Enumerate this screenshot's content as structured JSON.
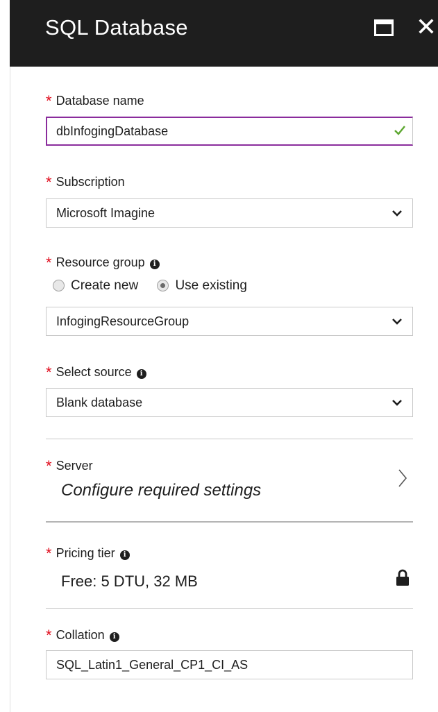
{
  "header": {
    "title": "SQL Database"
  },
  "fields": {
    "database_name": {
      "label": "Database name",
      "value": "dbInfogingDatabase"
    },
    "subscription": {
      "label": "Subscription",
      "value": "Microsoft Imagine"
    },
    "resource_group": {
      "label": "Resource group",
      "options": [
        "Create new",
        "Use existing"
      ],
      "selected_option": "Use existing",
      "value": "InfogingResourceGroup"
    },
    "select_source": {
      "label": "Select source",
      "value": "Blank database"
    },
    "server": {
      "label": "Server",
      "value": "Configure required settings"
    },
    "pricing_tier": {
      "label": "Pricing tier",
      "value": "Free: 5 DTU, 32 MB"
    },
    "collation": {
      "label": "Collation",
      "value": "SQL_Latin1_General_CP1_CI_AS"
    }
  },
  "colors": {
    "header_bg": "#1e1e1e",
    "required_star": "#e00b1c",
    "active_border": "#8a2c9c",
    "valid_check": "#5ea832"
  },
  "icons": [
    "maximize-icon",
    "close-icon",
    "check-icon",
    "chevron-down-icon",
    "info-icon",
    "chevron-right-icon",
    "lock-icon"
  ]
}
